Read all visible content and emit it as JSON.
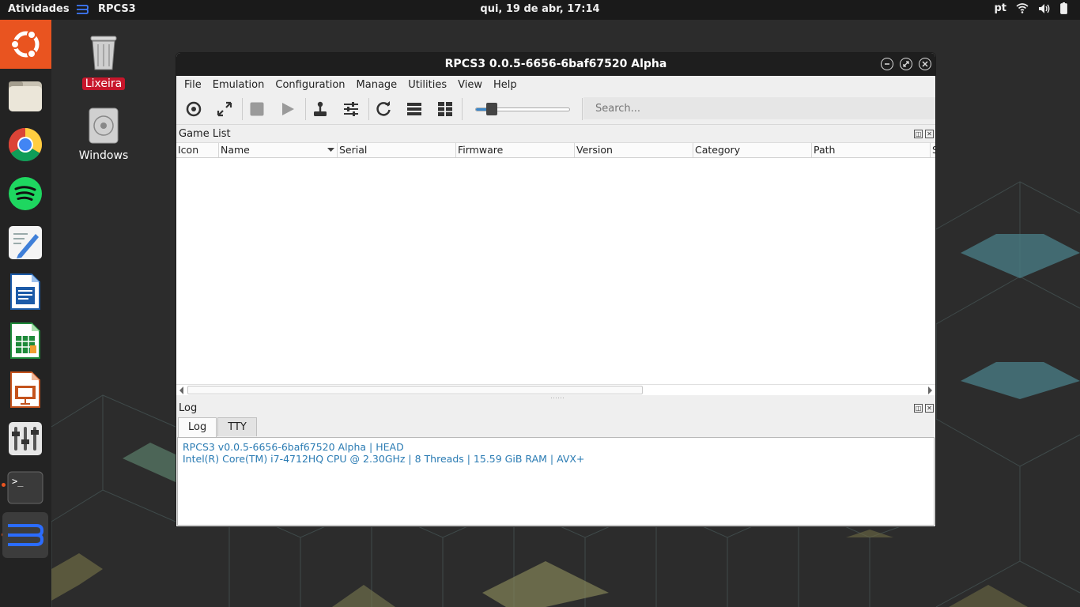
{
  "topbar": {
    "activities": "Atividades",
    "app_name": "RPCS3",
    "clock": "qui, 19 de abr, 17:14",
    "lang": "pt",
    "icons": [
      "wifi-icon",
      "volume-icon",
      "battery-icon"
    ]
  },
  "dock": {
    "items": [
      "ubuntu-icon",
      "files-icon",
      "chrome-icon",
      "spotify-icon",
      "text-editor-icon",
      "writer-icon",
      "calc-icon",
      "impress-icon",
      "settings-icon",
      "terminal-icon",
      "rpcs3-icon"
    ],
    "accent": "#e95420"
  },
  "desktop": {
    "icons": [
      {
        "label": "Lixeira",
        "icon": "trash-icon"
      },
      {
        "label": "Windows",
        "icon": "disc-icon"
      }
    ]
  },
  "window": {
    "title": "RPCS3 0.0.5-6656-6baf67520 Alpha",
    "menu": [
      "File",
      "Emulation",
      "Configuration",
      "Manage",
      "Utilities",
      "View",
      "Help"
    ],
    "toolbar_icons": [
      "boot-disc-icon",
      "fullscreen-icon",
      "stop-icon",
      "play-icon",
      "gamepad-icon",
      "config-sliders-icon",
      "refresh-icon",
      "list-view-icon",
      "grid-view-icon"
    ],
    "zoom_level": 0.15,
    "search_placeholder": "Search...",
    "game_list": {
      "title": "Game List",
      "columns": [
        "Icon",
        "Name",
        "Serial",
        "Firmware",
        "Version",
        "Category",
        "Path",
        "S"
      ]
    },
    "log": {
      "title": "Log",
      "tabs": [
        "Log",
        "TTY"
      ],
      "lines": [
        "RPCS3 v0.0.5-6656-6baf67520 Alpha | HEAD",
        "Intel(R) Core(TM) i7-4712HQ CPU @ 2.30GHz | 8 Threads | 15.59 GiB RAM | AVX+"
      ],
      "text_color": "#2a7bb3"
    }
  }
}
